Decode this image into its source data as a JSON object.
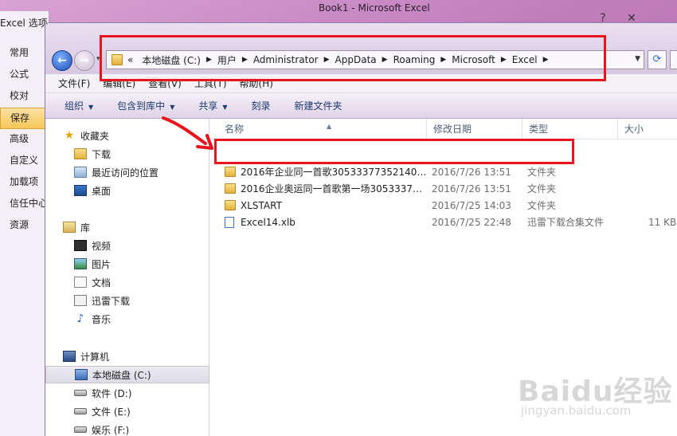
{
  "background_window": {
    "title": "Book1 - Microsoft Excel",
    "controls": {
      "help": "?",
      "close": "✕"
    }
  },
  "options_panel": {
    "title": "Excel 选项",
    "items": [
      {
        "label": "常用",
        "active": false
      },
      {
        "label": "公式",
        "active": false
      },
      {
        "label": "校对",
        "active": false
      },
      {
        "label": "保存",
        "active": true
      },
      {
        "label": "高级",
        "active": false
      },
      {
        "label": "自定义",
        "active": false
      },
      {
        "label": "加载项",
        "active": false
      },
      {
        "label": "信任中心",
        "active": false
      },
      {
        "label": "资源",
        "active": false
      }
    ]
  },
  "address_bar": {
    "lead": "«",
    "crumbs": [
      "本地磁盘 (C:)",
      "用户",
      "Administrator",
      "AppData",
      "Roaming",
      "Microsoft",
      "Excel"
    ]
  },
  "menubar": [
    "文件(F)",
    "编辑(E)",
    "查看(V)",
    "工具(T)",
    "帮助(H)"
  ],
  "toolbar": [
    {
      "label": "组织",
      "dropdown": true
    },
    {
      "label": "包含到库中",
      "dropdown": true
    },
    {
      "label": "共享",
      "dropdown": true
    },
    {
      "label": "刻录",
      "dropdown": false
    },
    {
      "label": "新建文件夹",
      "dropdown": false
    }
  ],
  "nav_pane": {
    "favorites_header": "收藏夹",
    "favorites": [
      {
        "label": "下载",
        "icon": "folder-icon"
      },
      {
        "label": "最近访问的位置",
        "icon": "recent-places-icon"
      },
      {
        "label": "桌面",
        "icon": "desktop-icon"
      }
    ],
    "libraries_header": "库",
    "libraries": [
      {
        "label": "视频",
        "icon": "video-icon"
      },
      {
        "label": "图片",
        "icon": "pictures-icon"
      },
      {
        "label": "文档",
        "icon": "document-icon"
      },
      {
        "label": "迅雷下载",
        "icon": "xunlei-icon"
      },
      {
        "label": "音乐",
        "icon": "music-icon"
      }
    ],
    "computer_header": "计算机",
    "drives": [
      {
        "label": "本地磁盘 (C:)",
        "selected": true
      },
      {
        "label": "软件 (D:)",
        "selected": false
      },
      {
        "label": "文件 (E:)",
        "selected": false
      },
      {
        "label": "娱乐 (F:)",
        "selected": false
      }
    ]
  },
  "file_list": {
    "columns": [
      "名称",
      "修改日期",
      "类型",
      "大小"
    ],
    "rows": [
      {
        "name": "2016年企业同一首歌305333773521404...",
        "date": "2016/7/26 13:51",
        "type": "文件夹",
        "size": "",
        "kind": "folder"
      },
      {
        "name": "2016企业奥运同一首歌第一场30533377...",
        "date": "2016/7/26 13:51",
        "type": "文件夹",
        "size": "",
        "kind": "folder"
      },
      {
        "name": "XLSTART",
        "date": "2016/7/25 14:03",
        "type": "文件夹",
        "size": "",
        "kind": "folder"
      },
      {
        "name": "Excel14.xlb",
        "date": "2016/7/25 22:48",
        "type": "迅雷下载合集文件",
        "size": "11 KB",
        "kind": "file"
      }
    ]
  },
  "watermark": {
    "logo": "Baidu经验",
    "sub": "jingyan.baidu.com"
  },
  "colors": {
    "highlight_red": "#e8141e",
    "active_option": "#f6c85a",
    "toolbar_text": "#1e3a6e"
  }
}
